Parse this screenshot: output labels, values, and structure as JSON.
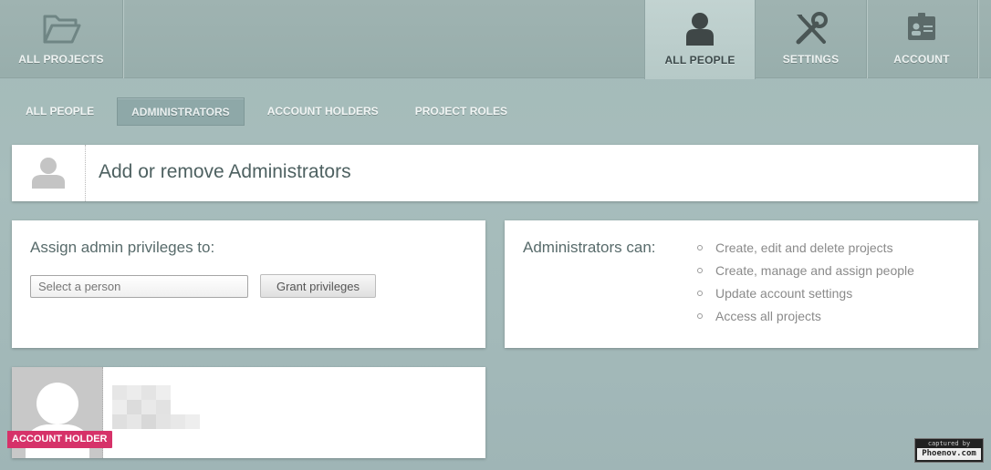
{
  "top_nav": {
    "tabs": [
      {
        "label": "ALL PROJECTS",
        "icon": "folder-icon"
      },
      {
        "label": "ALL PEOPLE",
        "icon": "person-icon",
        "active": true
      },
      {
        "label": "SETTINGS",
        "icon": "tools-icon"
      },
      {
        "label": "ACCOUNT",
        "icon": "id-card-icon"
      }
    ]
  },
  "sub_nav": {
    "tabs": [
      {
        "label": "ALL PEOPLE"
      },
      {
        "label": "ADMINISTRATORS",
        "active": true
      },
      {
        "label": "ACCOUNT HOLDERS"
      },
      {
        "label": "PROJECT ROLES"
      }
    ]
  },
  "header": {
    "title": "Add or remove Administrators"
  },
  "assign": {
    "heading": "Assign admin privileges to:",
    "select_placeholder": "Select a person",
    "button_label": "Grant privileges"
  },
  "admins_can": {
    "heading": "Administrators can:",
    "items": [
      "Create, edit and delete projects",
      "Create, manage and assign people",
      "Update account settings",
      "Access all projects"
    ]
  },
  "person_card": {
    "badge": "ACCOUNT HOLDER"
  },
  "watermark": {
    "line1": "captured by",
    "line2": "Phoenov.com"
  },
  "colors": {
    "background": "#a5bbba",
    "badge": "#d63269",
    "active_tab": "#bccfcd"
  }
}
